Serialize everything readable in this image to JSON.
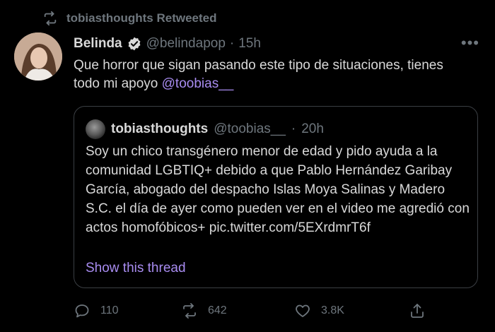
{
  "retweet": {
    "icon": "retweet-icon",
    "text": "tobiasthoughts Retweeted"
  },
  "tweet": {
    "author_name": "Belinda",
    "verified_icon": "verified-badge-icon",
    "handle": "@belindapop",
    "separator": "·",
    "time": "15h",
    "more_label": "•••",
    "text_before_mention": "Que horror que sigan pasando este tipo de situaciones, tienes todo mi apoyo ",
    "mention": "@toobias__"
  },
  "quoted": {
    "author_name": "tobiasthoughts",
    "handle": "@toobias__",
    "separator": "·",
    "time": "20h",
    "text": "Soy un chico transgénero menor de edad y pido ayuda a la comunidad LGBTIQ+ debido a que Pablo Hernández Garibay García, abogado del despacho Islas Moya Salinas y Madero S.C. el día de ayer como pueden ver en el video me agredió con actos homofóbicos+ pic.twitter.com/5EXrdmrT6f",
    "show_thread": "Show this thread"
  },
  "actions": {
    "reply_count": "110",
    "retweet_count": "642",
    "like_count": "3.8K"
  },
  "colors": {
    "background": "#000000",
    "text": "#d9d9d9",
    "muted": "#6e767d",
    "link": "#a88cf0",
    "border": "#3b3f44"
  }
}
